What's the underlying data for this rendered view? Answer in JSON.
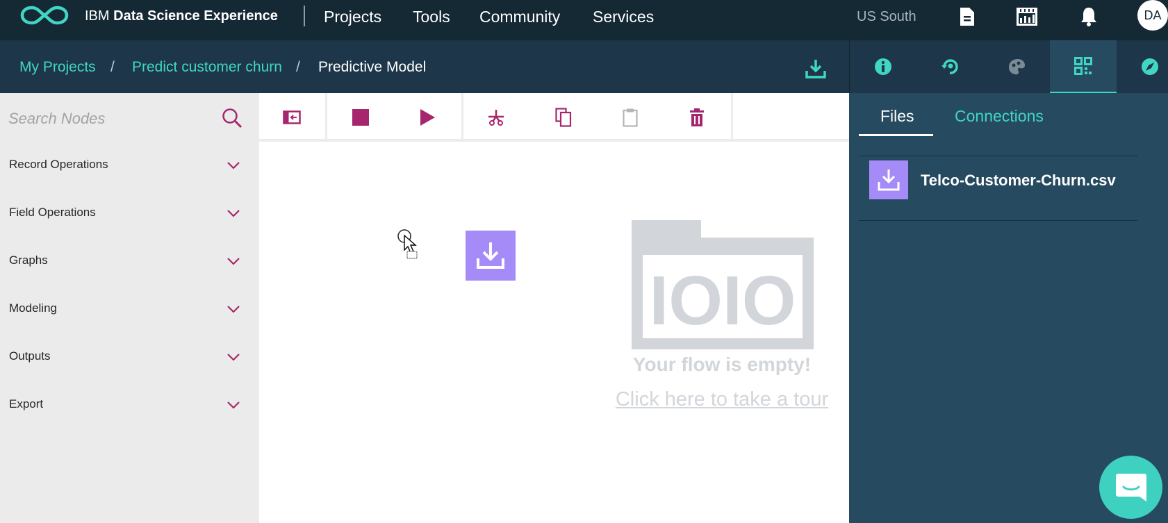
{
  "app": {
    "brand_prefix": "IBM",
    "brand_name": "Data Science Experience",
    "nav": [
      "Projects",
      "Tools",
      "Community",
      "Services"
    ],
    "region": "US South",
    "avatar_initials": "DA",
    "top_icons": [
      "document-icon",
      "calendar-grid-icon",
      "bell-icon"
    ]
  },
  "breadcrumb": {
    "items": [
      "My Projects",
      "Predict customer churn"
    ],
    "current": "Predictive Model",
    "separator": "/"
  },
  "right_tabs": {
    "icons": [
      "info-icon",
      "refresh-rocket-icon",
      "palette-icon",
      "data-assets-icon",
      "compass-icon"
    ],
    "active": "data-assets-icon"
  },
  "palette": {
    "search_placeholder": "Search Nodes",
    "categories": [
      "Record Operations",
      "Field Operations",
      "Graphs",
      "Modeling",
      "Outputs",
      "Export"
    ]
  },
  "toolbar": {
    "buttons": [
      "sidebar-toggle-icon",
      "stop-icon",
      "run-icon",
      "cut-icon",
      "copy-icon",
      "paste-icon",
      "delete-icon"
    ]
  },
  "canvas": {
    "empty_message": "Your flow is empty!",
    "tour_link": "Click here to take a tour",
    "empty_graphic_text": "IOIO",
    "dragged_node_icon": "import-icon"
  },
  "data_panel": {
    "tabs": [
      "Files",
      "Connections"
    ],
    "active_tab": "Files",
    "files": [
      "Telco-Customer-Churn.csv"
    ]
  },
  "colors": {
    "topbar_bg": "#152935",
    "crumbbar_bg": "#1d3649",
    "panel_bg": "#264a60",
    "accent_teal": "#41d6c3",
    "magenta": "#a6266e",
    "node_purple": "#a58bf7",
    "palette_bg": "#ebebeb"
  }
}
